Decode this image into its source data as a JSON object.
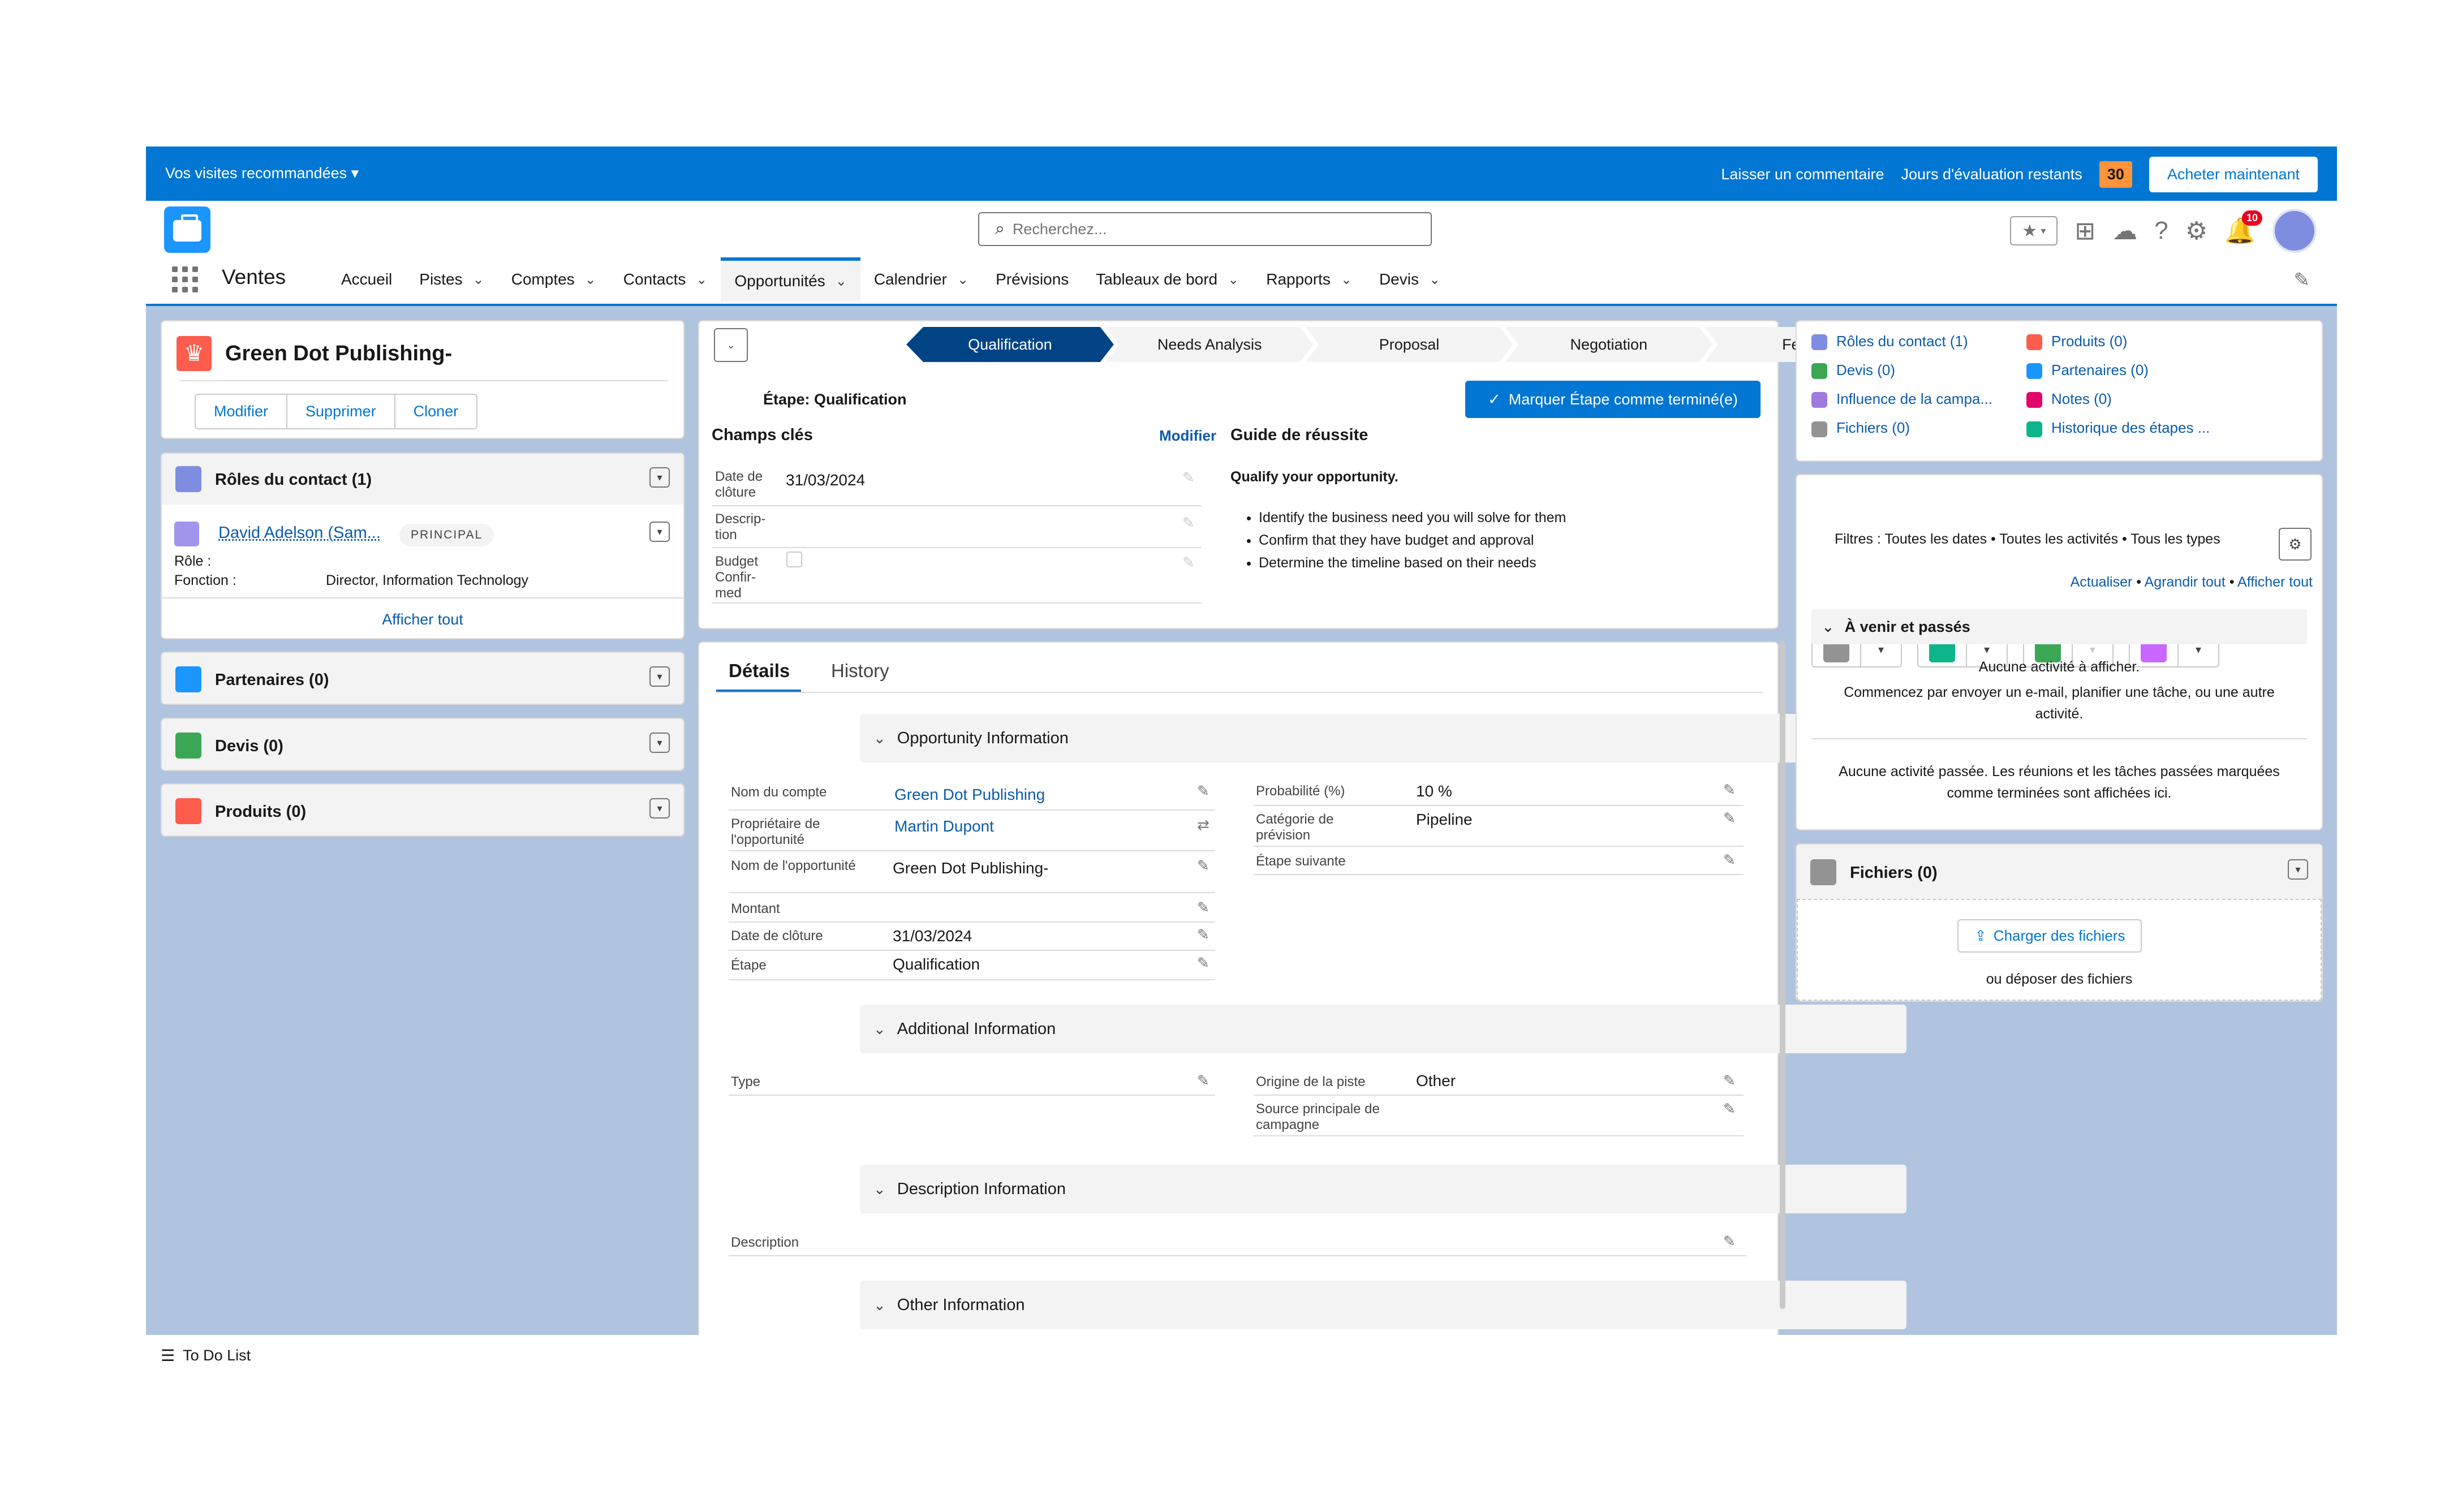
{
  "banner": {
    "guided": "Vos visites recommandées",
    "feedback": "Laisser un commentaire",
    "trial_label": "Jours d'évaluation restants",
    "trial_count": "30",
    "buy": "Acheter maintenant"
  },
  "header": {
    "search_placeholder": "Recherchez...",
    "notif_count": "10"
  },
  "nav": {
    "app_name": "Ventes",
    "items": [
      "Accueil",
      "Pistes",
      "Comptes",
      "Contacts",
      "Opportunités",
      "Calendrier",
      "Prévisions",
      "Tableaux de bord",
      "Rapports",
      "Devis"
    ]
  },
  "record": {
    "title": "Green Dot Publishing-",
    "actions": [
      "Modifier",
      "Supprimer",
      "Cloner"
    ]
  },
  "left": {
    "contact_roles": {
      "title": "Rôles du contact (1)",
      "contact_name": "David Adelson (Sam...",
      "badge": "PRINCIPAL",
      "role_label": "Rôle :",
      "fonction_label": "Fonction :",
      "fonction_value": "Director, Information Technology",
      "view_all": "Afficher tout"
    },
    "partners": "Partenaires (0)",
    "quotes": "Devis (0)",
    "products": "Produits (0)"
  },
  "path": {
    "stages": [
      "Qualification",
      "Needs Analysis",
      "Proposal",
      "Negotiation",
      "Fermée"
    ],
    "current_stage_text": "Étape: Qualification",
    "mark_complete": "Marquer Étape comme terminé(e)"
  },
  "key_fields": {
    "title": "Champs clés",
    "edit": "Modifier",
    "close_date_label": "Date de clôture",
    "close_date_value": "31/03/2024",
    "description_label": "Descrip-tion",
    "budget_label": "Budget Confir-med"
  },
  "guidance": {
    "title": "Guide de réussite",
    "heading": "Qualify your opportunity.",
    "bullets": [
      "Identify the business need you will solve for them",
      "Confirm that they have budget and approval",
      "Determine the timeline based on their needs"
    ]
  },
  "tabs": [
    "Détails",
    "History"
  ],
  "details": {
    "opp_info": "Opportunity Information",
    "account_name_label": "Nom du compte",
    "account_name": "Green Dot Publishing",
    "owner_label": "Propriétaire de l'opportunité",
    "owner": "Martin Dupont",
    "opp_name_label": "Nom de l'opportunité",
    "opp_name": "Green Dot Publishing-",
    "amount_label": "Montant",
    "close_date_label": "Date de clôture",
    "close_date": "31/03/2024",
    "stage_label": "Étape",
    "stage": "Qualification",
    "probability_label": "Probabilité (%)",
    "probability": "10 %",
    "forecast_label": "Catégorie de prévision",
    "forecast": "Pipeline",
    "next_step_label": "Étape suivante",
    "additional_info": "Additional Information",
    "type_label": "Type",
    "lead_source_label": "Origine de la piste",
    "lead_source": "Other",
    "campaign_label": "Source principale de campagne",
    "description_info": "Description Information",
    "description_label": "Description",
    "other_info": "Other Information"
  },
  "related": {
    "links": [
      "Rôles du contact (1)",
      "Produits (0)",
      "Devis (0)",
      "Partenaires (0)",
      "Influence de la campa...",
      "Notes (0)",
      "Fichiers (0)",
      "Historique des étapes ..."
    ]
  },
  "activity": {
    "filters": "Filtres : Toutes les dates • Toutes les activités • Tous les types",
    "refresh": "Actualiser",
    "expand": "Agrandir tout",
    "view_all": "Afficher tout",
    "upcoming_title": "À venir et passés",
    "no_activity": "Aucune activité à afficher.",
    "no_activity_hint": "Commencez par envoyer un e-mail, planifier une tâche, ou une autre activité.",
    "no_past": "Aucune activité passée. Les réunions et les tâches passées marquées comme terminées sont affichées ici."
  },
  "files": {
    "title": "Fichiers (0)",
    "upload": "Charger des fichiers",
    "drop": "ou déposer des fichiers"
  },
  "footer": {
    "todo": "To Do List"
  },
  "colors": {
    "brand": "#0176d3",
    "path_current": "#014486",
    "background": "#b0c4df"
  }
}
